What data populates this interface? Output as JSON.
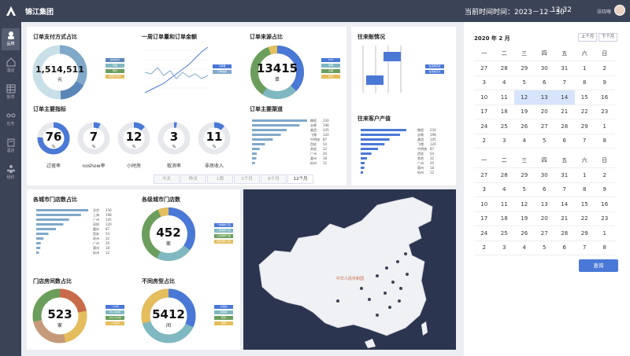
{
  "header": {
    "company": "锦江集团",
    "datetime_label": "当前时间时间：2023－12－30",
    "time": "12:32",
    "user": "张晓曦"
  },
  "nav": [
    {
      "label": "品牌",
      "icon": "person-icon"
    },
    {
      "label": "酒店",
      "icon": "home-icon"
    },
    {
      "label": "报表",
      "icon": "table-icon"
    },
    {
      "label": "任务",
      "icon": "link-icon"
    },
    {
      "label": "酒店",
      "icon": "building-icon"
    },
    {
      "label": "组织",
      "icon": "org-icon"
    }
  ],
  "panels": {
    "pay": {
      "title": "订单支付方式占比",
      "value": "1,514,511",
      "unit": "元",
      "legend": [
        "在线支付",
        "现金",
        "预付",
        "储值卡支付"
      ]
    },
    "weekly": {
      "title": "一周订单量和订单金额",
      "legend": [
        "订单量",
        "订单金额"
      ]
    },
    "source": {
      "title": "订单来源占比",
      "value": "13415",
      "unit": "单",
      "legend": [
        "OTA",
        "官网",
        "分销",
        "协议"
      ]
    },
    "main_kpi": {
      "title": "订单主要指标",
      "gauges": [
        {
          "value": "76",
          "unit": "%",
          "label": "过夜率",
          "pct": 0.76
        },
        {
          "value": "7",
          "unit": "%",
          "label": "noshow率",
          "pct": 0.07
        },
        {
          "value": "12",
          "unit": "%",
          "label": "小时房",
          "pct": 0.12
        },
        {
          "value": "3",
          "unit": "%",
          "label": "取消率",
          "pct": 0.03
        },
        {
          "value": "11",
          "unit": "%",
          "label": "非房收入",
          "pct": 0.11
        }
      ]
    },
    "channel": {
      "title": "订单主要渠道",
      "rows": [
        [
          "携程",
          "230"
        ],
        [
          "去哪",
          "198"
        ],
        [
          "美团",
          "145"
        ],
        [
          "飞猪",
          "120"
        ],
        [
          "中明旅",
          "87"
        ],
        [
          "西软",
          "54"
        ],
        [
          "其他",
          "32"
        ],
        [
          "广州",
          "20"
        ],
        [
          "惠州",
          "18"
        ],
        [
          "杭州",
          "12"
        ]
      ]
    },
    "regular": {
      "title": "往来账情况",
      "legend": [
        "往来账应收",
        "往来账应付"
      ]
    },
    "customer": {
      "title": "往来客户产值",
      "rows": [
        [
          "携程",
          "230"
        ],
        [
          "去哪",
          "198"
        ],
        [
          "美团",
          "145"
        ],
        [
          "飞猪",
          "120"
        ],
        [
          "中明旅",
          "87"
        ],
        [
          "西软",
          "54"
        ],
        [
          "其他",
          "32"
        ],
        [
          "广州",
          "20"
        ],
        [
          "惠州",
          "18"
        ],
        [
          "杭州",
          "12"
        ]
      ]
    },
    "city_stores": {
      "title": "各城市门店数占比",
      "rows": [
        [
          "北京",
          "230"
        ],
        [
          "上海",
          "198"
        ],
        [
          "广州",
          "145"
        ],
        [
          "深圳",
          "120"
        ],
        [
          "重庆",
          "87"
        ],
        [
          "西安",
          "54"
        ],
        [
          "苏州",
          "32"
        ],
        [
          "广州",
          "20"
        ],
        [
          "惠州",
          "18"
        ],
        [
          "杭州",
          "12"
        ]
      ]
    },
    "each_city": {
      "title": "各级城市门店数",
      "value": "452",
      "unit": "家",
      "legend": [
        "一线城市门店",
        "二线城市门店",
        "三线城市门店",
        "四线城市门店"
      ]
    },
    "room_ratio": {
      "title": "门店房间数占比",
      "value": "523",
      "unit": "家",
      "legend": [
        "<50间",
        "50-100间",
        "100-200间",
        ">200间"
      ]
    },
    "room_type": {
      "title": "不同房型占比",
      "value": "5412",
      "unit": "间",
      "legend": [
        "大床房",
        "双床房",
        "套房",
        "其他"
      ]
    }
  },
  "tabs": [
    "今天",
    "昨天",
    "1周",
    "1个月",
    "6个月",
    "12个月"
  ],
  "selected_tab": "12个月",
  "map": {
    "label": "中华人民共和国"
  },
  "calendar": {
    "title": "2020 年 2 月",
    "prev": "上个月",
    "next": "下个月",
    "weekdays": [
      "一",
      "二",
      "三",
      "四",
      "五",
      "六",
      "日"
    ],
    "month1": [
      [
        "27",
        "28",
        "29",
        "30",
        "31",
        "1",
        "2"
      ],
      [
        "3",
        "4",
        "5",
        "6",
        "7",
        "8",
        "9"
      ],
      [
        "10",
        "11",
        "12",
        "13",
        "14",
        "15",
        "16"
      ],
      [
        "17",
        "18",
        "19",
        "20",
        "21",
        "22",
        "23"
      ],
      [
        "24",
        "25",
        "26",
        "27",
        "28",
        "29",
        "1"
      ],
      [
        "2",
        "3",
        "4",
        "5",
        "6",
        "7",
        "8"
      ]
    ],
    "month2": [
      [
        "27",
        "28",
        "29",
        "30",
        "31",
        "1",
        "2"
      ],
      [
        "3",
        "4",
        "5",
        "6",
        "7",
        "8",
        "9"
      ],
      [
        "10",
        "11",
        "12",
        "13",
        "14",
        "15",
        "16"
      ],
      [
        "17",
        "18",
        "19",
        "20",
        "21",
        "22",
        "23"
      ],
      [
        "24",
        "25",
        "26",
        "27",
        "28",
        "29",
        "1"
      ],
      [
        "2",
        "3",
        "4",
        "5",
        "6",
        "7",
        "8"
      ]
    ],
    "query": "查询"
  },
  "colors": {
    "blue": "#4a78d6",
    "green": "#6b9e5c",
    "teal": "#7fb8c0",
    "yellow": "#e4bd5c",
    "red": "#c96b4b",
    "navy": "#3b4456"
  }
}
